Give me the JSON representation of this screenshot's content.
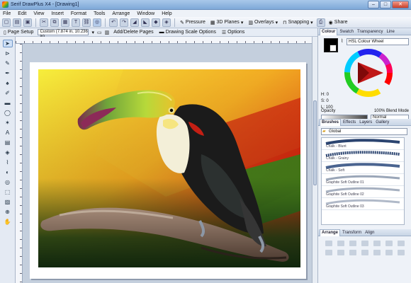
{
  "window": {
    "title": "Serif DrawPlus X4 - [Drawing1]",
    "btn_min": "–",
    "btn_max": "□",
    "btn_close": "✕"
  },
  "menu": [
    "File",
    "Edit",
    "View",
    "Insert",
    "Format",
    "Tools",
    "Arrange",
    "Window",
    "Help"
  ],
  "toolbar": {
    "pressure": "Pressure",
    "planes": "3D Planes",
    "overlays": "Overlays",
    "snapping": "Snapping",
    "share": "Share"
  },
  "context_bar": {
    "page_setup": "Page Setup",
    "page_size": "Custom (7.874 in, 10.236 in)",
    "add_delete": "Add/Delete Pages",
    "drawing_scale": "Drawing Scale Options",
    "options": "Options"
  },
  "colour_panel": {
    "tabs": [
      "Colour",
      "Swatch",
      "Transparency",
      "Line"
    ],
    "mode": "HSL Colour Wheel",
    "h": "H: 0",
    "s": "S: 0",
    "l": "L: 100",
    "opacity_label": "Opacity",
    "opacity_value": "100%",
    "blend_label": "Blend Mode",
    "blend_value": "Normal"
  },
  "brushes_panel": {
    "tabs": [
      "Brushes",
      "Effects",
      "Layers",
      "Gallery"
    ],
    "category": "Global",
    "items": [
      "Chalk - Blunt",
      "Chalk - Grainy",
      "Chalk - Soft",
      "Graphite Soft Outline 01",
      "Graphite Soft Outline 02",
      "Graphite Soft Outline 03"
    ]
  },
  "arrange_panel": {
    "tabs": [
      "Arrange",
      "Transform",
      "Align"
    ]
  },
  "colors": {
    "accent": "#2a62b8",
    "panel": "#eef2f8",
    "artwork_top": "#f7ea3a",
    "artwork_bottom": "#1c3a14"
  }
}
